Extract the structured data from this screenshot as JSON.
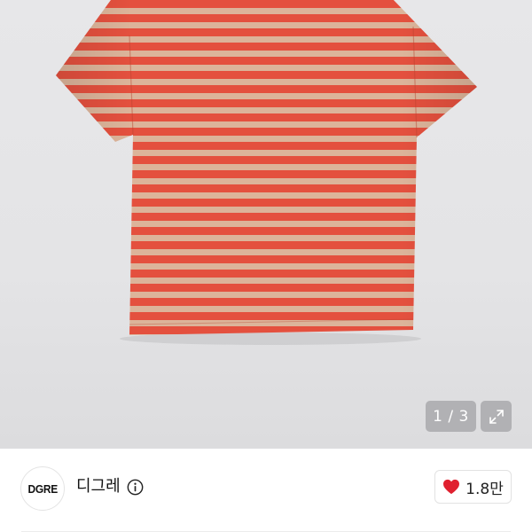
{
  "gallery": {
    "counter": "1 / 3",
    "expand_icon": "expand-icon",
    "stripe_colors": {
      "red": "#e4503e",
      "beige": "#dcb49a"
    }
  },
  "seller": {
    "avatar_text": "DGRE",
    "name": "디그레",
    "info_icon": "info-icon"
  },
  "like": {
    "icon": "heart-icon",
    "count": "1.8만",
    "color": "#e0202f"
  }
}
